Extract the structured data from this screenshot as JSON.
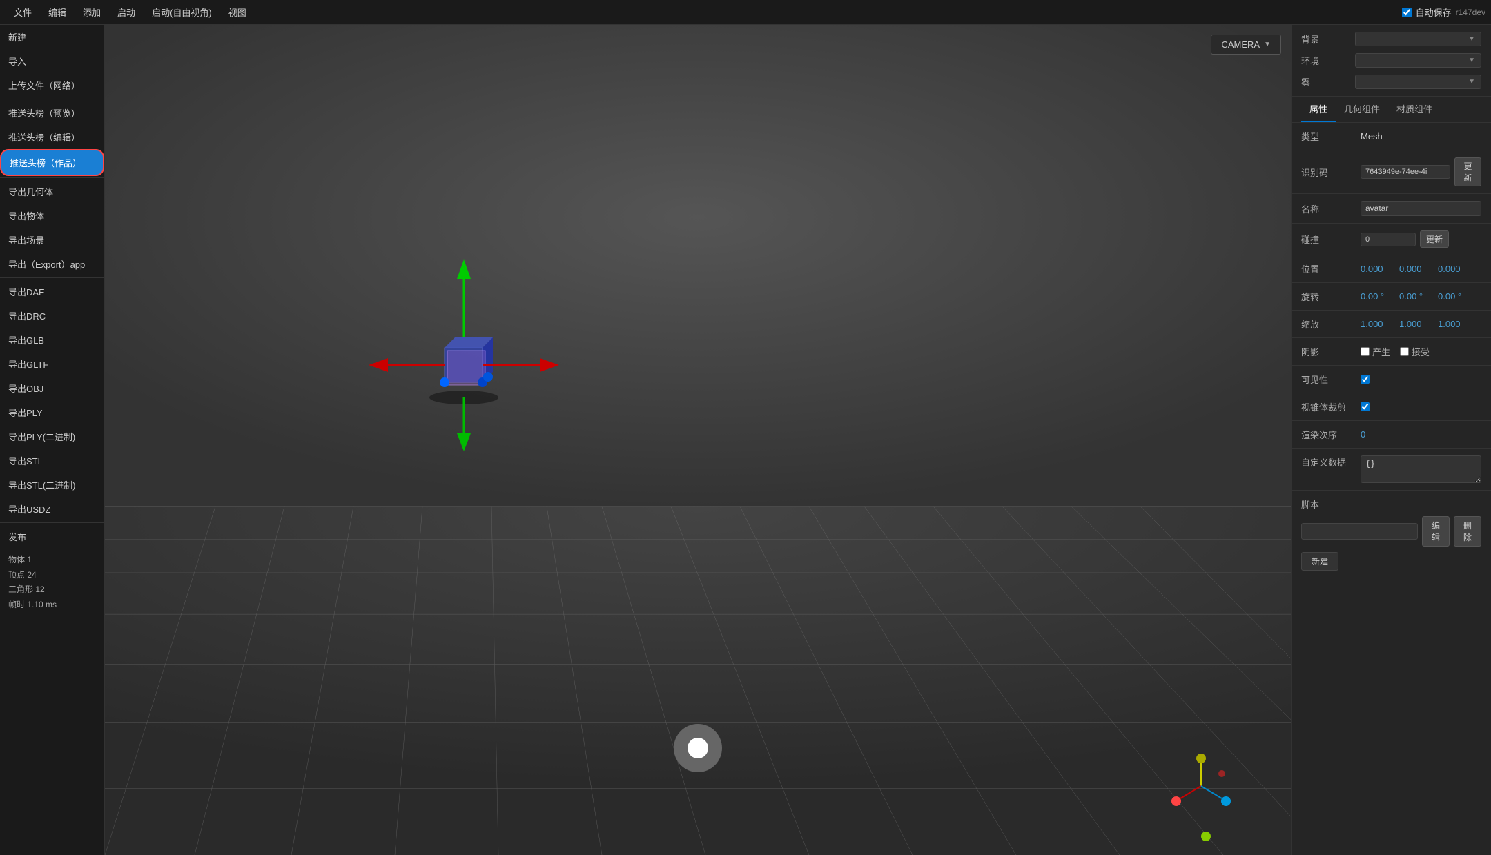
{
  "menubar": {
    "items": [
      "文件",
      "编辑",
      "添加",
      "启动",
      "启动(自由视角)",
      "视图"
    ],
    "autosave_label": "自动保存",
    "version": "r147dev"
  },
  "sidebar": {
    "items": [
      {
        "id": "new",
        "label": "新建"
      },
      {
        "id": "import",
        "label": "导入"
      },
      {
        "id": "upload",
        "label": "上传文件（网络）"
      },
      {
        "id": "push-preview",
        "label": "推送头榜（预览）"
      },
      {
        "id": "push-edit",
        "label": "推送头榜（编辑）"
      },
      {
        "id": "push-work",
        "label": "推送头榜（作品）",
        "active": true
      },
      {
        "id": "export-geo",
        "label": "导出几何体"
      },
      {
        "id": "export-obj",
        "label": "导出物体"
      },
      {
        "id": "export-scene",
        "label": "导出场景"
      },
      {
        "id": "export-app",
        "label": "导出（Export）app"
      },
      {
        "id": "export-dae",
        "label": "导出DAE"
      },
      {
        "id": "export-drc",
        "label": "导出DRC"
      },
      {
        "id": "export-glb",
        "label": "导出GLB"
      },
      {
        "id": "export-gltf",
        "label": "导出GLTF"
      },
      {
        "id": "export-obj2",
        "label": "导出OBJ"
      },
      {
        "id": "export-ply",
        "label": "导出PLY"
      },
      {
        "id": "export-ply-bin",
        "label": "导出PLY(二进制)"
      },
      {
        "id": "export-stl",
        "label": "导出STL"
      },
      {
        "id": "export-stl-bin",
        "label": "导出STL(二进制)"
      },
      {
        "id": "export-usdz",
        "label": "导出USDZ"
      }
    ],
    "publish_label": "发布",
    "stats": {
      "objects": "物体  1",
      "vertices": "顶点  24",
      "triangles": "三角形  12",
      "frame_time": "帧时  1.10 ms"
    }
  },
  "viewport": {
    "camera_button": "CAMERA",
    "camera_chevron": "▼"
  },
  "right_panel": {
    "background_label": "背景",
    "environment_label": "环境",
    "fog_label": "雾",
    "tabs": [
      "属性",
      "几何组件",
      "材质组件"
    ],
    "active_tab": "属性",
    "properties": {
      "type_label": "类型",
      "type_value": "Mesh",
      "id_label": "识别码",
      "id_value": "7643949e-74ee-4i",
      "update_label": "更新",
      "name_label": "名称",
      "name_value": "avatar",
      "collision_label": "碰撞",
      "collision_value": "0",
      "update2_label": "更新",
      "position_label": "位置",
      "pos_x": "0.000",
      "pos_y": "0.000",
      "pos_z": "0.000",
      "rotation_label": "旋转",
      "rot_x": "0.00 °",
      "rot_y": "0.00 °",
      "rot_z": "0.00 °",
      "scale_label": "缩放",
      "scale_x": "1.000",
      "scale_y": "1.000",
      "scale_z": "1.000",
      "shadow_label": "阴影",
      "shadow_cast": "产生",
      "shadow_receive": "接受",
      "visibility_label": "可见性",
      "frustum_label": "视锥体裁剪",
      "render_order_label": "渲染次序",
      "render_order_value": "0",
      "custom_data_label": "自定义数据",
      "custom_data_value": "{}",
      "script_label": "脚本",
      "edit_label": "编辑",
      "delete_label": "删除",
      "new_label": "新建"
    }
  }
}
